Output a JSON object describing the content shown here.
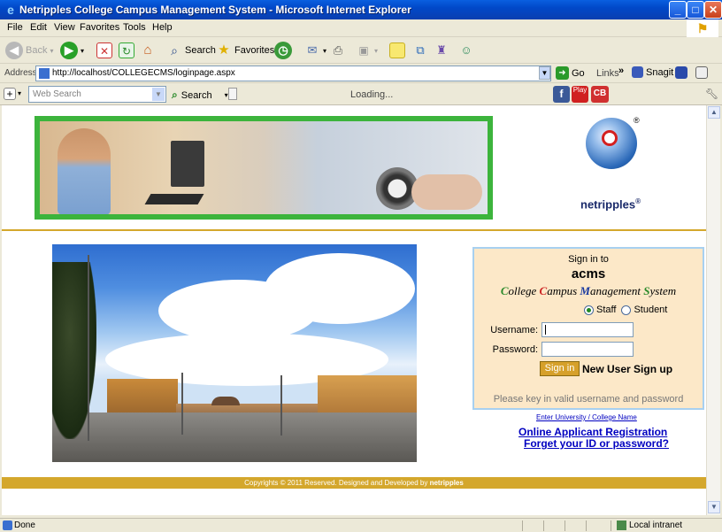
{
  "window": {
    "title": "Netripples College Campus Management System - Microsoft Internet Explorer",
    "minimize": "_",
    "maximize": "□",
    "close": "✕"
  },
  "menu": [
    "File",
    "Edit",
    "View",
    "Favorites",
    "Tools",
    "Help"
  ],
  "toolbar": {
    "back": "Back",
    "search": "Search",
    "favorites": "Favorites"
  },
  "address": {
    "label": "Address",
    "url": "http://localhost/COLLEGECMS/loginpage.aspx",
    "go": "Go",
    "links": "Links",
    "snagit": "Snagit"
  },
  "searchbar": {
    "placeholder": "Web Search",
    "search_label": "Search",
    "loading": "Loading..."
  },
  "header": {
    "brand": "netripples",
    "reg": "®"
  },
  "signin": {
    "sign_in_to": "Sign in to",
    "product": "acms",
    "tagline_parts": [
      {
        "cap": "C",
        "rest": "ollege ",
        "color": "#2a8a2a"
      },
      {
        "cap": "C",
        "rest": "ampus ",
        "color": "#cc2222"
      },
      {
        "cap": "M",
        "rest": "anagement ",
        "color": "#1a3aa0"
      },
      {
        "cap": "S",
        "rest": "ystem",
        "color": "#2a8a2a"
      }
    ],
    "role_staff": "Staff",
    "role_student": "Student",
    "selected_role": "Staff",
    "username_label": "Username:",
    "password_label": "Password:",
    "username_value": "",
    "password_value": "",
    "signin_button": "Sign in",
    "new_user": "New User Sign up",
    "hint": "Please key in valid username and password"
  },
  "links": {
    "enter_university": "Enter University / College Name",
    "online_registration": "Online Applicant Registration",
    "forgot": "Forget your ID or password?"
  },
  "footer": {
    "text": "Copyrights © 2011 Reserved. Designed and Developed by",
    "brand": "netripples"
  },
  "status": {
    "left": "Done",
    "zone": "Local intranet"
  },
  "colors": {
    "accent_gold": "#d4a72c",
    "link_blue": "#0000c0",
    "banner_green": "#3cb43c",
    "signin_bg": "#fce8c8"
  }
}
